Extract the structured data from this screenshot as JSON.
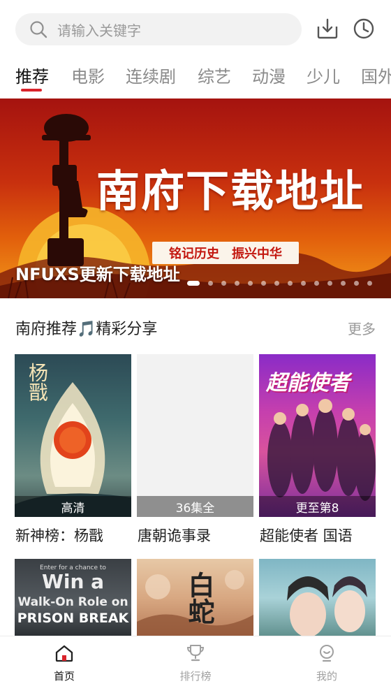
{
  "search": {
    "placeholder": "请输入关键字",
    "icons": [
      "search-icon",
      "download-icon",
      "history-clock-icon"
    ]
  },
  "tabs": [
    {
      "label": "推荐",
      "active": true
    },
    {
      "label": "电影",
      "active": false
    },
    {
      "label": "连续剧",
      "active": false
    },
    {
      "label": "综艺",
      "active": false
    },
    {
      "label": "动漫",
      "active": false
    },
    {
      "label": "少儿",
      "active": false
    },
    {
      "label": "国外",
      "active": false
    }
  ],
  "banner": {
    "headline": "南府下载地址",
    "slogan": "铭记历史　振兴中华",
    "caption": "NFUXS更新下载地址",
    "slide_count": 14,
    "active_slide": 1
  },
  "section": {
    "title": "南府推荐🎵精彩分享",
    "more": "更多"
  },
  "cards": [
    {
      "title": "新神榜：杨戬",
      "badge": "高清",
      "poster_text": "杨戬"
    },
    {
      "title": "唐朝诡事录",
      "badge": "36集全",
      "poster_text": ""
    },
    {
      "title": "超能使者 国语",
      "badge": "更至第8",
      "poster_text": "超能使者"
    }
  ],
  "cards_row2": [
    {
      "poster_text_1": "Enter for a chance to",
      "poster_text_2": "Win a",
      "poster_text_3": "Walk-On Role on",
      "poster_text_4": "PRISON BREAK"
    },
    {
      "poster_text_1": "白蛇"
    },
    {
      "poster_text_1": ""
    }
  ],
  "nav": [
    {
      "label": "首页",
      "icon": "home-icon",
      "active": true
    },
    {
      "label": "排行榜",
      "icon": "trophy-icon",
      "active": false
    },
    {
      "label": "我的",
      "icon": "profile-icon",
      "active": false
    }
  ],
  "colors": {
    "accent": "#d9232b",
    "banner_red": "#c8300e",
    "banner_orange": "#f29a1a"
  }
}
